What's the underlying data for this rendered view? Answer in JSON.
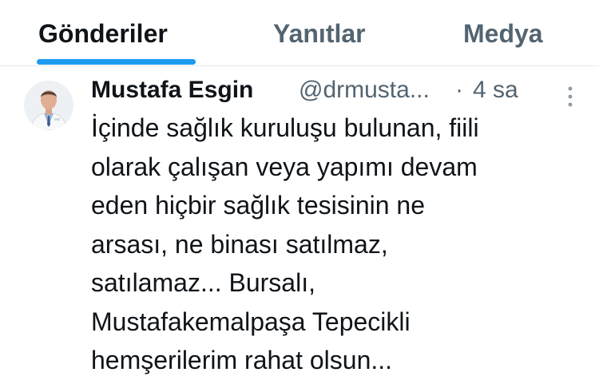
{
  "tabs": [
    {
      "label": "Gönderiler",
      "active": true
    },
    {
      "label": "Yanıtlar",
      "active": false
    },
    {
      "label": "Medya",
      "active": false
    }
  ],
  "accent_color": "#1d9bf0",
  "tweet": {
    "author_name": "Mustafa Esgin",
    "author_handle": "@drmusta...",
    "separator": "·",
    "time": "4 sa",
    "text_lines": [
      "İçinde sağlık kuruluşu bulunan, fiili",
      "olarak çalışan veya yapımı devam",
      "eden hiçbir sağlık tesisinin ne",
      "arsası, ne binası satılmaz,",
      "satılamaz... Bursalı,",
      "Mustafakemalpaşa Tepecikli",
      "hemşerilerim rahat olsun..."
    ],
    "avatar_icon": "profile-photo",
    "more_icon": "more-vertical-icon"
  }
}
